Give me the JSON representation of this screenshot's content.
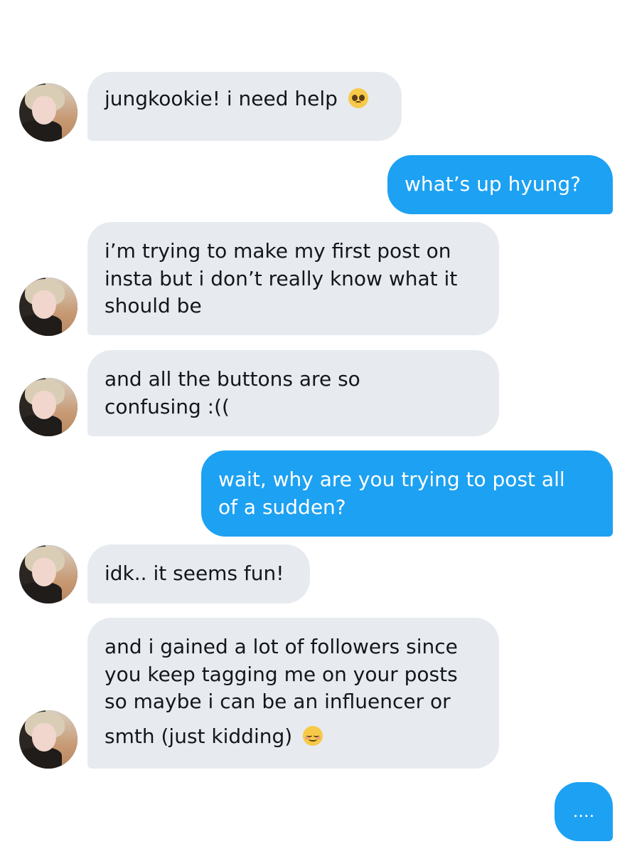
{
  "conversation": {
    "messages": [
      {
        "sender": "jimin",
        "text": "jungkookie! i need help",
        "emoji": "pleading-face-emoji"
      },
      {
        "sender": "me",
        "text": "what’s up hyung?"
      },
      {
        "sender": "jimin",
        "lines": [
          "i’m trying to make my first post on",
          "insta but i don’t really know what it",
          "should be"
        ]
      },
      {
        "sender": "jimin",
        "lines": [
          "and all the buttons are so",
          "confusing :(("
        ]
      },
      {
        "sender": "me",
        "lines": [
          "wait, why are you trying to post all",
          "of a sudden?"
        ]
      },
      {
        "sender": "jimin",
        "text": "idk.. it seems fun!"
      },
      {
        "sender": "jimin",
        "lines": [
          "and i gained a lot of followers since",
          "you keep tagging me on your posts",
          "so maybe i can be an influencer or",
          "smth (just kidding)"
        ],
        "emoji": "smiling-face-emoji"
      },
      {
        "sender": "me",
        "text": "...."
      }
    ]
  },
  "colors": {
    "incoming_bubble": "#e7ebef",
    "outgoing_bubble": "#1da1f2",
    "incoming_text": "#14171a",
    "outgoing_text": "#ffffff"
  }
}
